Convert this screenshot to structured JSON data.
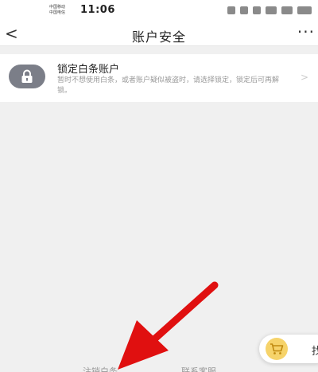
{
  "status_bar": {
    "carrier_1": "中国移动",
    "carrier_2": "中国电信",
    "time": "11:06"
  },
  "nav": {
    "back_glyph": "<",
    "title": "账户安全",
    "more_glyph": "···"
  },
  "lock_card": {
    "icon": "lock-icon",
    "title": "锁定白条账户",
    "description": "暂时不想使用白条，或者账户疑似被盗时，请选择锁定，锁定后可再解锁。",
    "chevron": ">"
  },
  "floating_cart": {
    "icon": "shopping-cart-icon",
    "label": "找",
    "accent": "#f6d36a"
  },
  "bottom_links": {
    "left": "注销白条",
    "right": "联系客服"
  },
  "annotation": {
    "type": "red-arrow",
    "color": "#e01010"
  }
}
